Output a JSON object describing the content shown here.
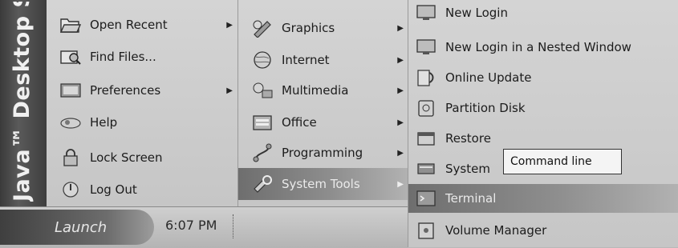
{
  "brand": {
    "text": "Java™ Desktop S"
  },
  "launch_menu": {
    "items": [
      {
        "label": "Open Recent",
        "icon": "folder-open-icon",
        "has_submenu": true
      },
      {
        "label": "Find Files...",
        "icon": "find-files-icon",
        "has_submenu": false
      },
      {
        "label": "Preferences",
        "icon": "preferences-icon",
        "has_submenu": true
      },
      {
        "label": "Help",
        "icon": "help-icon",
        "has_submenu": false
      },
      {
        "label": "Lock Screen",
        "icon": "lock-icon",
        "has_submenu": false
      },
      {
        "label": "Log Out",
        "icon": "logout-icon",
        "has_submenu": false
      }
    ]
  },
  "applications_menu": {
    "items": [
      {
        "label": "Graphics",
        "icon": "graphics-icon",
        "has_submenu": true
      },
      {
        "label": "Internet",
        "icon": "globe-icon",
        "has_submenu": true
      },
      {
        "label": "Multimedia",
        "icon": "multimedia-icon",
        "has_submenu": true
      },
      {
        "label": "Office",
        "icon": "office-icon",
        "has_submenu": true
      },
      {
        "label": "Programming",
        "icon": "programming-icon",
        "has_submenu": true
      },
      {
        "label": "System Tools",
        "icon": "system-tools-icon",
        "has_submenu": true,
        "selected": true
      }
    ]
  },
  "system_tools_menu": {
    "items": [
      {
        "label": "New Login",
        "icon": "monitor-icon"
      },
      {
        "label": "New Login in a Nested Window",
        "icon": "monitor-icon"
      },
      {
        "label": "Online Update",
        "icon": "online-update-icon"
      },
      {
        "label": "Partition Disk",
        "icon": "partition-disk-icon"
      },
      {
        "label": "Restore",
        "icon": "restore-icon"
      },
      {
        "label": "System",
        "icon": "system-icon"
      },
      {
        "label": "Terminal",
        "icon": "terminal-icon",
        "selected": true
      },
      {
        "label": "Volume Manager",
        "icon": "volume-manager-icon"
      }
    ]
  },
  "tooltip": {
    "text": "Command line"
  },
  "taskbar": {
    "launch_label": "Launch",
    "clock": "6:07 PM"
  },
  "colors": {
    "menu_bg": "#c9c9c9",
    "selected_bg": "#7a7a7a",
    "brand_bg": "#3e3e3e"
  }
}
